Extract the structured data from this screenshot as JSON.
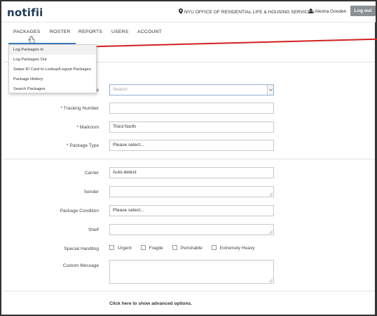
{
  "header": {
    "logo": "notifii",
    "location": "NYU OFFICE OF RESIDENTIAL LIFE & HOUSING SERVICES",
    "user_name": "Alesha Gooden",
    "logout_label": "Log out"
  },
  "nav": {
    "items": [
      "PACKAGES",
      "ROSTER",
      "REPORTS",
      "USERS",
      "ACCOUNT"
    ],
    "active": "PACKAGES"
  },
  "packages_menu": {
    "items": [
      "Log Packages In",
      "Log Packages Out",
      "Swipe ID Card to Lookup/Logout Packages",
      "Package History",
      "Search Packages"
    ]
  },
  "form": {
    "recipient": {
      "label_suffix": "e",
      "placeholder": "Search"
    },
    "tracking": {
      "label": "* Tracking Number",
      "value": ""
    },
    "mailroom": {
      "label": "* Mailroom",
      "value": "Third North"
    },
    "package_type": {
      "label": "* Package Type",
      "value": "Please select..."
    },
    "carrier": {
      "label": "Carrier",
      "value": "Auto-detect"
    },
    "sender": {
      "label": "Sender",
      "value": ""
    },
    "condition": {
      "label": "Package Condition",
      "value": "Please select..."
    },
    "shelf": {
      "label": "Shelf",
      "value": ""
    },
    "special_handling": {
      "label": "Special Handling",
      "options": [
        "Urgent",
        "Fragile",
        "Perishable",
        "Extremely Heavy"
      ]
    },
    "custom_message": {
      "label": "Custom Message",
      "value": ""
    },
    "advanced_link": "Click here to show advanced options."
  }
}
